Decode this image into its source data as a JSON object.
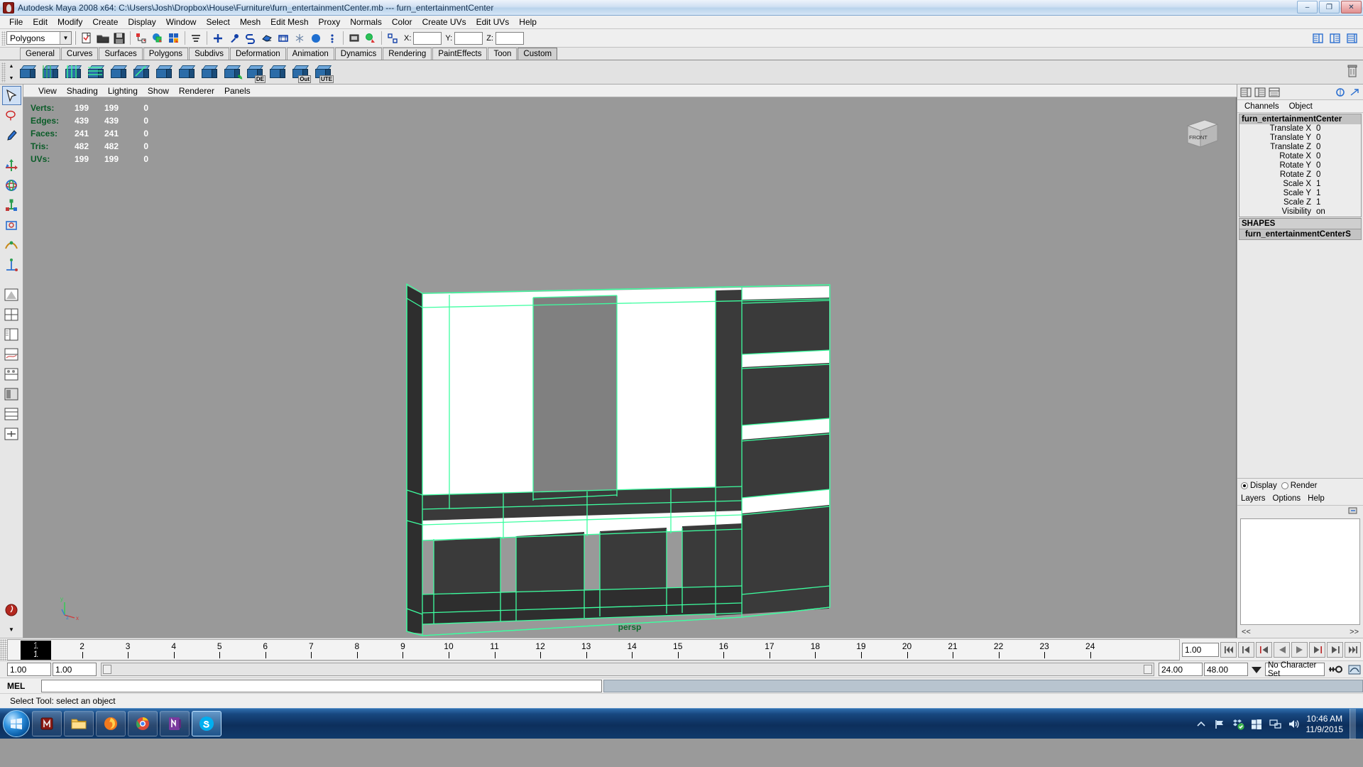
{
  "titlebar": {
    "title": "Autodesk Maya 2008 x64: C:\\Users\\Josh\\Dropbox\\House\\Furniture\\furn_entertainmentCenter.mb   ---   furn_entertainmentCenter",
    "minimize": "–",
    "maximize": "❐",
    "close": "✕"
  },
  "menubar": {
    "items": [
      "File",
      "Edit",
      "Modify",
      "Create",
      "Display",
      "Window",
      "Select",
      "Mesh",
      "Edit Mesh",
      "Proxy",
      "Normals",
      "Color",
      "Create UVs",
      "Edit UVs",
      "Help"
    ]
  },
  "statusline": {
    "mode_selector": "Polygons",
    "axis_labels": [
      "X:",
      "Y:",
      "Z:"
    ],
    "axis_values": [
      "",
      "",
      ""
    ],
    "icons": [
      "new-scene-icon",
      "open-scene-icon",
      "save-scene-icon",
      "select-by-hierarchy-icon",
      "select-by-object-icon",
      "select-by-component-icon",
      "snap-grid-icon",
      "construction-history-icon",
      "render-current-frame-icon",
      "ipr-render-icon",
      "render-settings-icon",
      "hypershade-icon",
      "lock-selection-icon",
      "highlight-selection-icon",
      "show-manipulator-icon",
      "soft-select-icon",
      "tweak-mode-icon",
      "paint-select-icon",
      "xray-icon",
      "light-xray-icon",
      "sidebar-toggle-icon"
    ]
  },
  "shelf": {
    "tabs": [
      "General",
      "Curves",
      "Surfaces",
      "Polygons",
      "Subdivs",
      "Deformation",
      "Animation",
      "Dynamics",
      "Rendering",
      "PaintEffects",
      "Toon",
      "Custom"
    ],
    "active_tab": "Custom",
    "buttons": [
      {
        "name": "shelf-cube-1",
        "label": ""
      },
      {
        "name": "shelf-cube-2",
        "label": ""
      },
      {
        "name": "shelf-cube-3",
        "label": ""
      },
      {
        "name": "shelf-cube-4",
        "label": ""
      },
      {
        "name": "shelf-cube-5",
        "label": ""
      },
      {
        "name": "shelf-cube-6",
        "label": ""
      },
      {
        "name": "shelf-cube-7",
        "label": ""
      },
      {
        "name": "shelf-cube-8",
        "label": ""
      },
      {
        "name": "shelf-cube-9",
        "label": ""
      },
      {
        "name": "shelf-cube-10",
        "label": ""
      },
      {
        "name": "shelf-cube-de",
        "label": "DE"
      },
      {
        "name": "shelf-cube-11",
        "label": ""
      },
      {
        "name": "shelf-cube-out",
        "label": "Out"
      },
      {
        "name": "shelf-cube-ute",
        "label": "UTE"
      }
    ],
    "trash_icon": "trash-icon"
  },
  "toolbox": {
    "tools": [
      {
        "name": "select-tool",
        "selected": true
      },
      {
        "name": "lasso-select-tool",
        "selected": false
      },
      {
        "name": "paint-select-tool",
        "selected": false
      },
      {
        "name": "move-tool",
        "selected": false
      },
      {
        "name": "rotate-tool",
        "selected": false
      },
      {
        "name": "scale-tool",
        "selected": false
      },
      {
        "name": "universal-manipulator-tool",
        "selected": false
      },
      {
        "name": "soft-modification-tool",
        "selected": false
      },
      {
        "name": "show-manipulator-tool",
        "selected": false
      },
      {
        "name": "last-tool-used",
        "selected": false
      },
      {
        "name": "layout-single-perspective",
        "selected": false
      },
      {
        "name": "layout-four-view",
        "selected": false
      },
      {
        "name": "layout-persp-outliner",
        "selected": false
      },
      {
        "name": "layout-persp-graph",
        "selected": false
      },
      {
        "name": "layout-hypershade-persp",
        "selected": false
      },
      {
        "name": "layout-persp-render",
        "selected": false
      },
      {
        "name": "layout-two-stacked",
        "selected": false
      },
      {
        "name": "layout-more",
        "selected": false
      },
      {
        "name": "paint-effects-brush",
        "selected": false
      }
    ]
  },
  "panel": {
    "menus": [
      "View",
      "Shading",
      "Lighting",
      "Show",
      "Renderer",
      "Panels"
    ],
    "camera_label": "persp",
    "viewcube_label": "FRONT",
    "axis_x": "x",
    "axis_y": "y",
    "axis_z": "z"
  },
  "hud": {
    "rows": [
      {
        "label": "Verts:",
        "total": "199",
        "selected": "199",
        "extra": "0"
      },
      {
        "label": "Edges:",
        "total": "439",
        "selected": "439",
        "extra": "0"
      },
      {
        "label": "Faces:",
        "total": "241",
        "selected": "241",
        "extra": "0"
      },
      {
        "label": "Tris:",
        "total": "482",
        "selected": "482",
        "extra": "0"
      },
      {
        "label": "UVs:",
        "total": "199",
        "selected": "199",
        "extra": "0"
      }
    ]
  },
  "channelbox": {
    "tabs": [
      "Channels",
      "Object"
    ],
    "object_name": "furn_entertainmentCenter",
    "attributes": [
      {
        "label": "Translate X",
        "value": "0"
      },
      {
        "label": "Translate Y",
        "value": "0"
      },
      {
        "label": "Translate Z",
        "value": "0"
      },
      {
        "label": "Rotate X",
        "value": "0"
      },
      {
        "label": "Rotate Y",
        "value": "0"
      },
      {
        "label": "Rotate Z",
        "value": "0"
      },
      {
        "label": "Scale X",
        "value": "1"
      },
      {
        "label": "Scale Y",
        "value": "1"
      },
      {
        "label": "Scale Z",
        "value": "1"
      },
      {
        "label": "Visibility",
        "value": "on"
      }
    ],
    "shapes_header": "SHAPES",
    "shape_name": "furn_entertainmentCenterS",
    "toolbar_icons": [
      "channel-box-icon",
      "attribute-editor-icon",
      "tool-settings-icon",
      "channels-edit-icon",
      "channels-show-icon"
    ]
  },
  "layers": {
    "display_label": "Display",
    "render_label": "Render",
    "display_selected": true,
    "menus": [
      "Layers",
      "Options",
      "Help"
    ],
    "prev_label": "<<",
    "next_label": ">>",
    "new_layer_icon": "new-layer-icon"
  },
  "timeslider": {
    "ticks": [
      "1",
      "2",
      "3",
      "4",
      "5",
      "6",
      "7",
      "8",
      "9",
      "10",
      "11",
      "12",
      "13",
      "14",
      "15",
      "16",
      "17",
      "18",
      "19",
      "20",
      "21",
      "22",
      "23",
      "24"
    ],
    "current_frame": "1",
    "current_frame_sub": "1",
    "current_time_field": "1.00",
    "playback_buttons": [
      {
        "name": "go-to-start-button",
        "glyph": "⏮"
      },
      {
        "name": "step-back-key-button",
        "glyph": "⏴"
      },
      {
        "name": "step-back-frame-button",
        "glyph": "◀"
      },
      {
        "name": "play-backwards-button",
        "glyph": "◀"
      },
      {
        "name": "play-forwards-button",
        "glyph": "▶"
      },
      {
        "name": "step-forward-frame-button",
        "glyph": "▶"
      },
      {
        "name": "step-forward-key-button",
        "glyph": "⏵"
      },
      {
        "name": "go-to-end-button",
        "glyph": "⏭"
      }
    ]
  },
  "rangeslider": {
    "anim_start": "1.00",
    "range_start": "1.00",
    "range_end": "24.00",
    "anim_end": "48.00",
    "character_set": "No Character Set",
    "auto_key_icon": "auto-key-icon",
    "anim_prefs_icon": "animation-preferences-icon"
  },
  "commandline": {
    "label": "MEL",
    "value": "",
    "placeholder": ""
  },
  "helpline": {
    "text": "Select Tool: select an object"
  },
  "taskbar": {
    "start_label": "start-orb",
    "items": [
      {
        "name": "taskbar-maya",
        "icon": "maya-icon",
        "active": false
      },
      {
        "name": "taskbar-explorer",
        "icon": "folder-icon",
        "active": false
      },
      {
        "name": "taskbar-firefox",
        "icon": "firefox-icon",
        "active": false
      },
      {
        "name": "taskbar-chrome",
        "icon": "chrome-icon",
        "active": false
      },
      {
        "name": "taskbar-onenote",
        "icon": "onenote-icon",
        "active": false
      },
      {
        "name": "taskbar-skype",
        "icon": "skype-icon",
        "active": true
      }
    ],
    "tray_icons": [
      "show-hidden-icons-icon",
      "flag-icon",
      "dropbox-icon",
      "windows-icon",
      "network-icon",
      "volume-icon"
    ],
    "time": "10:46 AM",
    "date": "11/9/2015"
  },
  "colors": {
    "viewport_bg": "#999999",
    "wireframe_selected": "#3dffa0",
    "mesh_dark": "#3a3a3a",
    "mesh_light": "#ffffff",
    "mesh_mid": "#808080",
    "hud_label": "#0a5c28",
    "hud_value": "#ffffff",
    "titlebar_text": "#16314f"
  }
}
